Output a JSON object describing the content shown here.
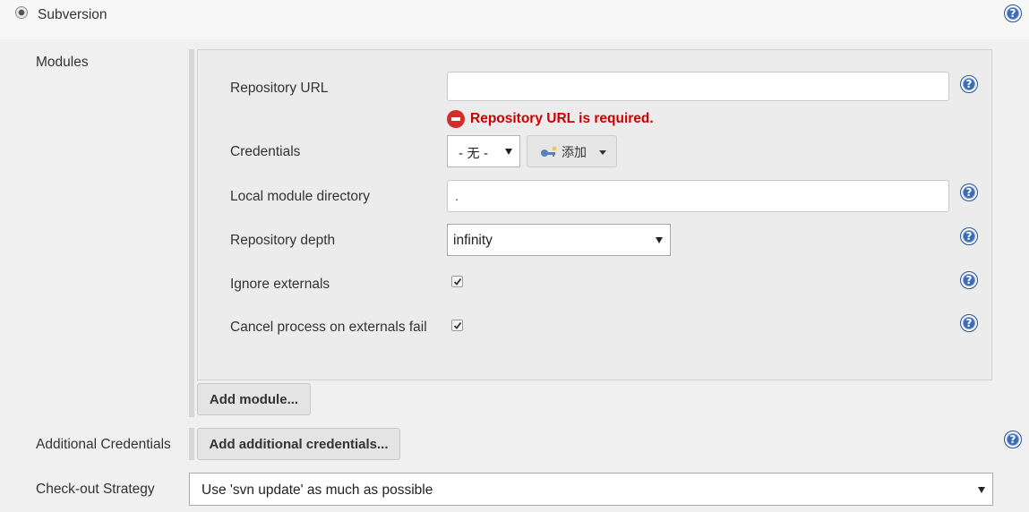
{
  "scm": {
    "option_label": "Subversion",
    "help": "?"
  },
  "modules": {
    "section_label": "Modules",
    "repository_url": {
      "label": "Repository URL",
      "value": "",
      "error": "Repository URL is required.",
      "help": "?"
    },
    "credentials": {
      "label": "Credentials",
      "selected": "- 无 -",
      "add_label": "添加"
    },
    "local_module_directory": {
      "label": "Local module directory",
      "value": ".",
      "help": "?"
    },
    "repository_depth": {
      "label": "Repository depth",
      "selected": "infinity",
      "help": "?"
    },
    "ignore_externals": {
      "label": "Ignore externals",
      "checked": true,
      "help": "?"
    },
    "cancel_on_externals_fail": {
      "label": "Cancel process on externals fail",
      "checked": true,
      "help": "?"
    },
    "add_module_label": "Add module..."
  },
  "additional_credentials": {
    "label": "Additional Credentials",
    "button_label": "Add additional credentials...",
    "help": "?"
  },
  "checkout_strategy": {
    "label": "Check-out Strategy",
    "selected": "Use 'svn update' as much as possible"
  },
  "colors": {
    "error": "#cc0000",
    "help_icon": "#3c6db4"
  }
}
